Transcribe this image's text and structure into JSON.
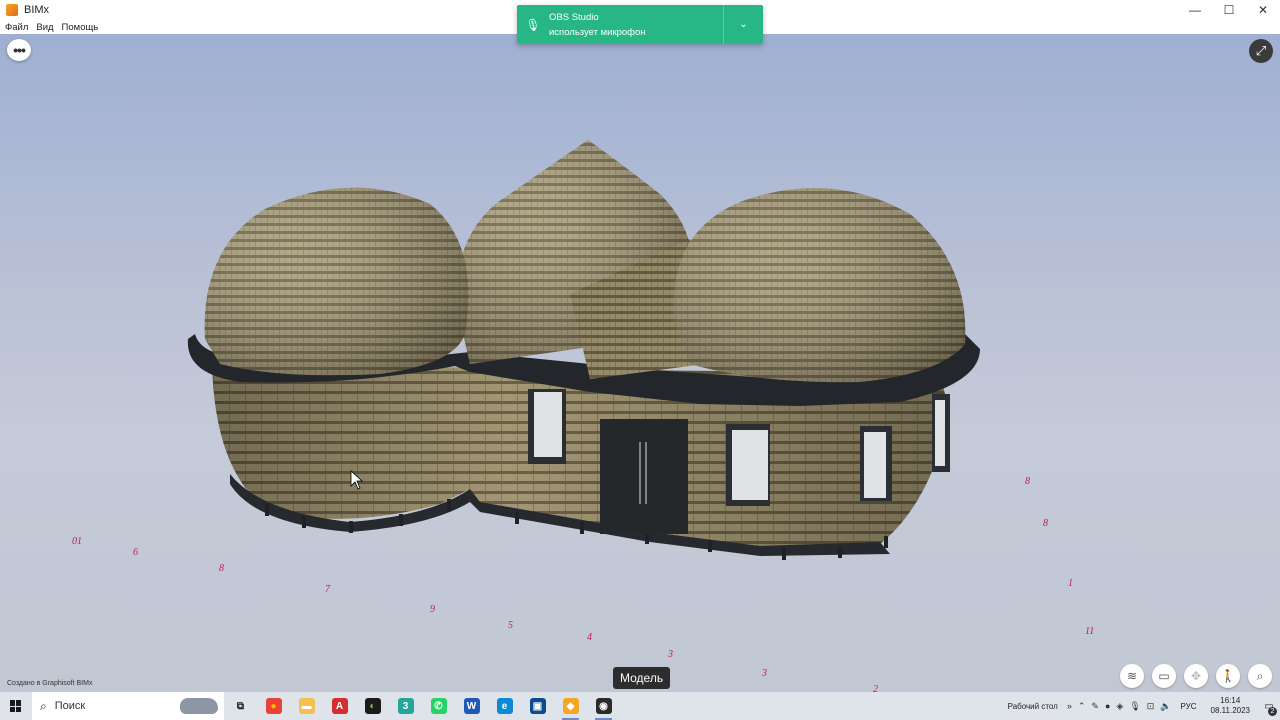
{
  "window": {
    "title": "BIMx",
    "minimize": "—",
    "maximize": "☐",
    "close": "✕"
  },
  "menu": [
    "Файл",
    "Вид",
    "Помощь"
  ],
  "notification": {
    "app": "OBS Studio",
    "message": "использует микрофон",
    "mic_icon": "microphone-icon",
    "chevron": "⌄"
  },
  "viewer": {
    "menu_symbol": "•••",
    "expand_symbol": "⤢",
    "credit": "Создано в Graphisoft BIMx",
    "mode_label": "Модель",
    "tools": [
      {
        "name": "layers-tool",
        "glyph": "≋"
      },
      {
        "name": "viewer-tool",
        "glyph": "▭"
      },
      {
        "name": "gamepad-tool",
        "glyph": "✥"
      },
      {
        "name": "walk-tool",
        "glyph": "🚶"
      },
      {
        "name": "search-tool",
        "glyph": "⌕"
      }
    ],
    "ground_labels": [
      {
        "text": "01",
        "color": "#c2185b"
      },
      {
        "text": "6",
        "color": "#c2185b"
      },
      {
        "text": "8",
        "color": "#c2185b"
      },
      {
        "text": "7",
        "color": "#c2185b"
      },
      {
        "text": "9",
        "color": "#c2185b"
      },
      {
        "text": "5",
        "color": "#c2185b"
      },
      {
        "text": "4",
        "color": "#c2185b"
      },
      {
        "text": "3",
        "color": "#c2185b"
      },
      {
        "text": "3",
        "color": "#c2185b"
      },
      {
        "text": "2",
        "color": "#c2185b"
      },
      {
        "text": "1",
        "color": "#c2185b"
      },
      {
        "text": "8",
        "color": "#c2185b"
      },
      {
        "text": "8",
        "color": "#c2185b"
      },
      {
        "text": "11",
        "color": "#c2185b"
      }
    ]
  },
  "taskbar": {
    "search_placeholder": "Поиск",
    "apps": [
      {
        "name": "task-view",
        "glyph": "⧉",
        "bg": "transparent",
        "fg": "#222"
      },
      {
        "name": "chrome",
        "glyph": "●",
        "bg": "#ea4335",
        "fg": "#fbbc05"
      },
      {
        "name": "file-explorer",
        "glyph": "▬",
        "bg": "#f2c14e",
        "fg": "#ffffff"
      },
      {
        "name": "acrobat",
        "glyph": "A",
        "bg": "#d32f2f",
        "fg": "#ffffff"
      },
      {
        "name": "app-green",
        "glyph": "◐",
        "bg": "#1b1b1b",
        "fg": "#8bc34a"
      },
      {
        "name": "app-3",
        "glyph": "3",
        "bg": "#26a69a",
        "fg": "#ffffff"
      },
      {
        "name": "whatsapp",
        "glyph": "✆",
        "bg": "#25d366",
        "fg": "#ffffff"
      },
      {
        "name": "app-word",
        "glyph": "W",
        "bg": "#1e5bb8",
        "fg": "#ffffff"
      },
      {
        "name": "edge",
        "glyph": "e",
        "bg": "#0c8ad6",
        "fg": "#ffffff"
      },
      {
        "name": "app-monitor",
        "glyph": "▣",
        "bg": "#0a4d8c",
        "fg": "#ffffff"
      },
      {
        "name": "bimx",
        "glyph": "◆",
        "bg": "#f5a623",
        "fg": "#ffffff"
      },
      {
        "name": "obs",
        "glyph": "◉",
        "bg": "#2b2b2b",
        "fg": "#ffffff"
      }
    ],
    "desktop_label": "Рабочий стол",
    "language": "РУС",
    "time": "16:14",
    "date": "08.11.2023",
    "notification_count": "2"
  }
}
